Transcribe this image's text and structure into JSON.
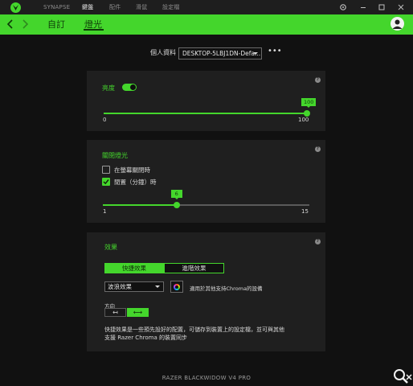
{
  "titlebar": {
    "nav": [
      "SYNAPSE",
      "鍵盤",
      "配件",
      "滑鼠",
      "設定檔"
    ],
    "active_index": 1
  },
  "subnav": {
    "tabs": [
      "自訂",
      "燈光"
    ],
    "active_index": 1
  },
  "profile": {
    "label": "個人資料",
    "value": "DESKTOP-5LBJ1DN-Defa..."
  },
  "brightness": {
    "title": "亮度",
    "enabled": true,
    "min_label": "0",
    "max_label": "100",
    "value": "100",
    "fraction": 1.0
  },
  "lights_off": {
    "title": "關閉燈光",
    "option_display_off": {
      "label": "在螢幕關閉時",
      "checked": false
    },
    "option_idle": {
      "label": "閒置（分鐘）時",
      "checked": true
    },
    "min_label": "1",
    "max_label": "15",
    "value": "6",
    "fraction": 0.357
  },
  "effects": {
    "title": "效果",
    "seg_quick": "快捷效果",
    "seg_advanced": "進階效果",
    "selected_effect": "波浪效果",
    "chroma_apply": "適用於其他支持Chroma的設備",
    "direction_label": "方向",
    "direction_left": "↤",
    "direction_right": "⟷",
    "description_line1": "快捷效果是一些預先設好的配置，可儲存到裝置上的設定檔，並可與其他",
    "description_line2": "支援 Razer Chroma 的裝置同步"
  },
  "footer": {
    "device": "RAZER BLACKWIDOW V4 PRO"
  },
  "colors": {
    "accent": "#44d62c",
    "panel": "#1f1f1f",
    "background": "#111111"
  }
}
